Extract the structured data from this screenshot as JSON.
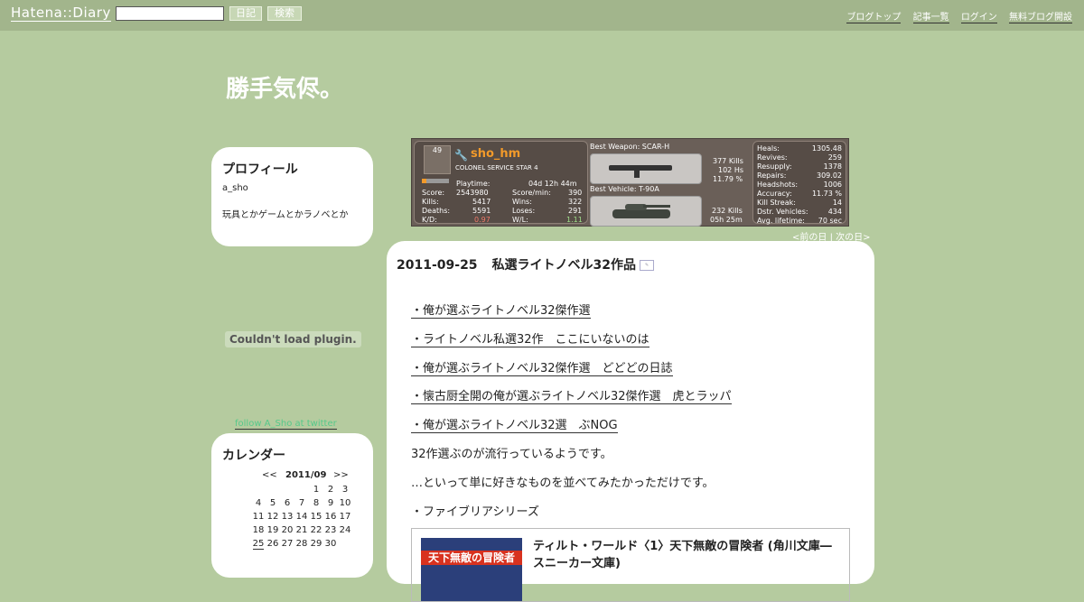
{
  "header": {
    "logo": "Hatena::Diary",
    "search_value": "",
    "diary_button": "日記",
    "search_button": "検索",
    "links": [
      "ブログトップ",
      "記事一覧",
      "ログイン",
      "無料ブログ開設"
    ]
  },
  "blog": {
    "title": "勝手気侭。"
  },
  "profile": {
    "heading": "プロフィール",
    "name": "a_sho",
    "description": "玩具とかゲームとかラノベとか"
  },
  "plugin_error": "Couldn't load plugin.",
  "follow_link": "follow A_Sho at twitter",
  "calendar": {
    "heading": "カレンダー",
    "prev": "<<",
    "month": "2011/09",
    "next": ">>",
    "weeks": [
      [
        "",
        "",
        "",
        "",
        "1",
        "2",
        "3"
      ],
      [
        "4",
        "5",
        "6",
        "7",
        "8",
        "9",
        "10"
      ],
      [
        "11",
        "12",
        "13",
        "14",
        "15",
        "16",
        "17"
      ],
      [
        "18",
        "19",
        "20",
        "21",
        "22",
        "23",
        "24"
      ],
      [
        "25",
        "26",
        "27",
        "28",
        "29",
        "30",
        ""
      ]
    ],
    "today": "25"
  },
  "stats_banner": {
    "rank_number": "49",
    "player": "sho_hm",
    "rank_title": "COLONEL SERVICE STAR 4",
    "playtime_label": "Playtime:",
    "playtime": "04d 12h 44m",
    "score_label": "Score:",
    "score": "2543980",
    "score_min_label": "Score/min:",
    "score_min": "390",
    "kills_label": "Kills:",
    "kills": "5417",
    "wins_label": "Wins:",
    "wins": "322",
    "deaths_label": "Deaths:",
    "deaths": "5591",
    "loses_label": "Loses:",
    "loses": "291",
    "kd_label": "K/D:",
    "kd": "0.97",
    "wl_label": "W/L:",
    "wl": "1.11",
    "best_weapon_label": "Best Weapon: SCAR-H",
    "weapon_kills": "377 Kills",
    "weapon_hs": "102 Hs",
    "weapon_pct": "11.79 %",
    "best_vehicle_label": "Best Vehicle: T-90A",
    "vehicle_kills": "232 Kills",
    "vehicle_time": "05h 25m",
    "right_stats": [
      {
        "label": "Heals:",
        "value": "1305.48"
      },
      {
        "label": "Revives:",
        "value": "259"
      },
      {
        "label": "Resupply:",
        "value": "1378"
      },
      {
        "label": "Repairs:",
        "value": "309.02"
      },
      {
        "label": "Headshots:",
        "value": "1006"
      },
      {
        "label": "Accuracy:",
        "value": "11.73 %"
      },
      {
        "label": "Kill Streak:",
        "value": "14"
      },
      {
        "label": "Dstr. Vehicles:",
        "value": "434"
      },
      {
        "label": "Avg. lifetime:",
        "value": "70 sec"
      }
    ]
  },
  "day_nav": {
    "prev": "<前の日",
    "separator": "|",
    "next": "次の日>"
  },
  "article": {
    "date": "2011-09-25",
    "title": "私選ライトノベル32作品",
    "links": [
      "・俺が選ぶライトノベル32傑作選",
      "・ライトノベル私選32作　ここにいないのは",
      "・俺が選ぶライトノベル32傑作選　どどどの日誌",
      "・懐古厨全開の俺が選ぶライトノベル32傑作選　虎とラッパ",
      "・俺が選ぶライトノベル32選　ぶNOG"
    ],
    "para1": "32作選ぶのが流行っているようです。",
    "para2": "…といって単に好きなものを並べてみたかっただけです。",
    "para3": "・ファイブリアシリーズ",
    "book_title": "ティルト・ワールド〈1〉天下無敵の冒険者 (角川文庫―スニーカー文庫)",
    "book_cover_text": "天下無敵の冒険者"
  }
}
